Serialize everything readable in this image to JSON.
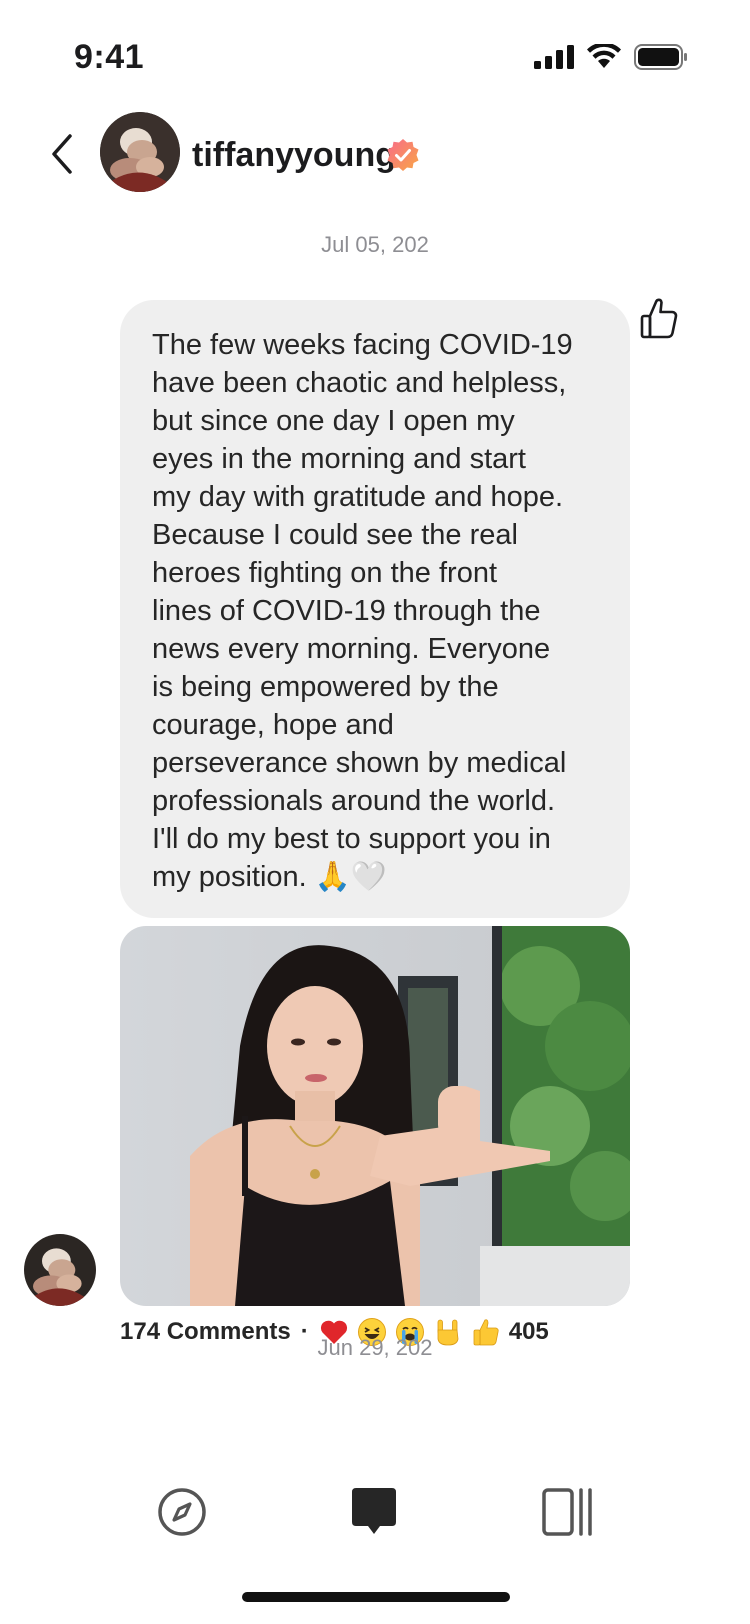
{
  "status_bar": {
    "time": "9:41",
    "battery_icon": "battery-icon",
    "wifi_icon": "wifi-icon",
    "signal_icon": "signal-icon"
  },
  "header": {
    "back_icon": "chevron-left-icon",
    "username": "tiffanyyoung",
    "verified_icon": "verified-badge-icon",
    "verified_color": "#f5568a"
  },
  "thread": {
    "date_top": "Jul 05, 202",
    "message": "The few weeks facing COVID-19\nhave been chaotic and helpless,\nbut since one day I open my\neyes in the morning and start\nmy day with gratitude and hope.\nBecause I could see the real\nheroes fighting on the front\nlines of COVID-19 through the\nnews every morning. Everyone\nis being empowered by the\ncourage, hope and\nperseverance shown by medical\nprofessionals around the world.\nI'll do my best to support you in\nmy position. 🙏🤍",
    "like_icon": "thumbs-up-icon",
    "comments": "174 Comments",
    "separator": "·",
    "reactions": [
      "heart",
      "laughing",
      "crying",
      "rock-on",
      "thumbs-up"
    ],
    "reaction_count": "405",
    "date_bottom": "Jun 29, 202"
  },
  "tabbar": {
    "items": [
      {
        "icon": "compass-icon"
      },
      {
        "icon": "chat-bubble-icon"
      },
      {
        "icon": "feed-icon"
      }
    ]
  }
}
